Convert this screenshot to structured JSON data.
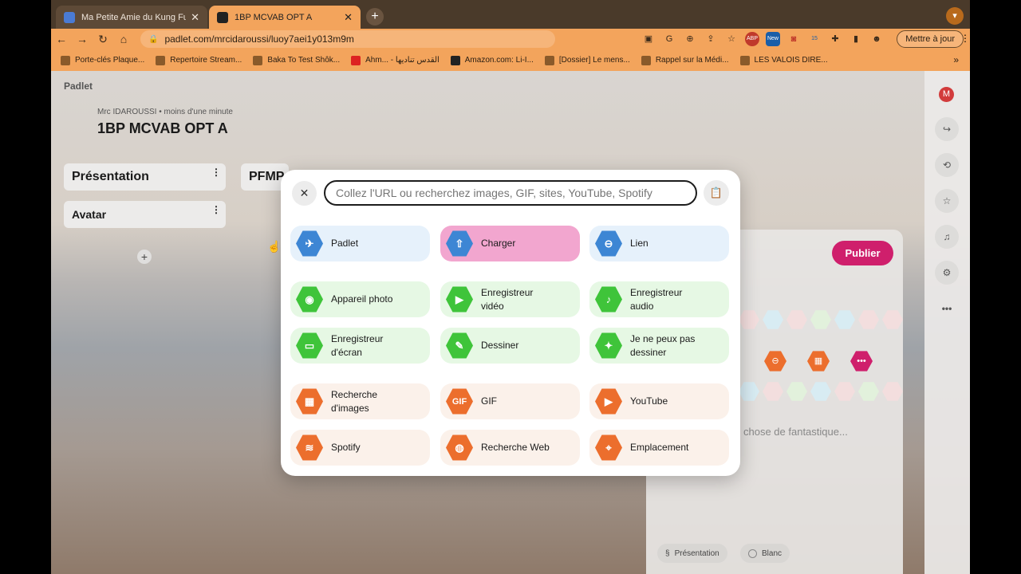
{
  "browser": {
    "tabs": [
      {
        "title": "Ma Petite Amie du Kung Fu - E"
      },
      {
        "title": "1BP MCVAB OPT A"
      }
    ],
    "new_tab": "+",
    "url": "padlet.com/mrcidaroussi/luoy7aei1y013m9m",
    "update_button": "Mettre à jour",
    "bookmarks": [
      "Porte-clés Plaque...",
      "Repertoire Stream...",
      "Baka To Test Shôk...",
      "Ahm... - القدس تناديها",
      "Amazon.com: Li-I...",
      "[Dossier] Le mens...",
      "Rappel sur la Médi...",
      "LES VALOIS DIRE..."
    ],
    "bookmarks_more": "»",
    "toolbar_icons": [
      "ABP",
      "New",
      "15"
    ]
  },
  "board": {
    "logo": "Padlet",
    "meta": "Mrc IDAROUSSI • moins d'une minute",
    "title": "1BP MCVAB OPT A",
    "columns": [
      "Présentation",
      "PFMP",
      "Avatar"
    ],
    "add": "+"
  },
  "sidebar": {
    "avatar": "M",
    "more": "•••"
  },
  "composer": {
    "publish": "Publier",
    "placeholder": "chose de fantastique...",
    "chips": [
      "Présentation",
      "Blanc"
    ]
  },
  "modal": {
    "search_placeholder": "Collez l'URL ou recherchez images, GIF, sites, YouTube, Spotify",
    "options": [
      {
        "label": "Padlet",
        "icon": "padlet-icon"
      },
      {
        "label": "Charger",
        "icon": "upload-icon"
      },
      {
        "label": "Lien",
        "icon": "link-icon"
      },
      {
        "label": "Appareil photo",
        "icon": "camera-icon"
      },
      {
        "label": "Enregistreur vidéo",
        "icon": "video-icon"
      },
      {
        "label": "Enregistreur audio",
        "icon": "microphone-icon"
      },
      {
        "label": "Enregistreur d'écran",
        "icon": "screen-icon"
      },
      {
        "label": "Dessiner",
        "icon": "brush-icon"
      },
      {
        "label": "Je ne peux pas dessiner",
        "icon": "sparkle-icon"
      },
      {
        "label": "Recherche d'images",
        "icon": "image-search-icon"
      },
      {
        "label": "GIF",
        "icon": "gif-icon"
      },
      {
        "label": "YouTube",
        "icon": "youtube-icon"
      },
      {
        "label": "Spotify",
        "icon": "spotify-icon"
      },
      {
        "label": "Recherche Web",
        "icon": "globe-icon"
      },
      {
        "label": "Emplacement",
        "icon": "location-icon"
      }
    ]
  },
  "colors": {
    "publish": "#cf1f6c",
    "blue": "#3d86d4",
    "green": "#3fc43a",
    "orange": "#ec6e2d"
  }
}
